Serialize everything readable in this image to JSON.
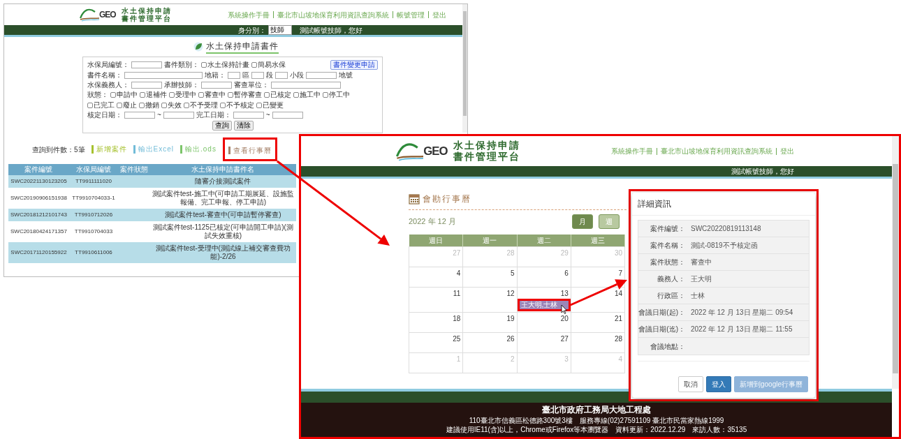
{
  "back_window": {
    "header": {
      "logo_text": "GEO",
      "title_lines": [
        "水土保持申請",
        "書件管理平台"
      ],
      "links": [
        "系統操作手冊",
        "臺北市山坡地保育利用資訊查詢系統",
        "帳號管理",
        "登出"
      ]
    },
    "user_bar": {
      "role_label": "身分別：",
      "role_value": "技師",
      "greeting": "測試帳號技師，您好"
    },
    "page_title": "水土保持申請書件",
    "search_form": [
      {
        "items": [
          {
            "kind": "label",
            "text": "水保局編號："
          },
          {
            "kind": "input",
            "wide": false
          },
          {
            "kind": "label",
            "text": "書件類別："
          },
          {
            "kind": "checkbox",
            "text": "水土保持計畫",
            "checked": false
          },
          {
            "kind": "checkbox",
            "text": "簡易水保",
            "checked": false
          },
          {
            "kind": "button",
            "text": "書件變更申請",
            "emphasis": true
          }
        ]
      },
      {
        "items": [
          {
            "kind": "label",
            "text": "書件名稱："
          },
          {
            "kind": "input",
            "wide": true
          },
          {
            "kind": "label",
            "text": "地籍："
          },
          {
            "kind": "select",
            "wide": false
          },
          {
            "kind": "label",
            "text": "區"
          },
          {
            "kind": "select",
            "wide": false
          },
          {
            "kind": "label",
            "text": "段"
          },
          {
            "kind": "select",
            "wide": false
          },
          {
            "kind": "label",
            "text": "小段"
          },
          {
            "kind": "input",
            "wide": false
          },
          {
            "kind": "label",
            "text": "地號"
          }
        ]
      },
      {
        "items": [
          {
            "kind": "label",
            "text": "水保義務人："
          },
          {
            "kind": "input",
            "wide": false
          },
          {
            "kind": "label",
            "text": "承辦技師："
          },
          {
            "kind": "input",
            "wide": false
          },
          {
            "kind": "label",
            "text": "審查單位："
          },
          {
            "kind": "select",
            "wide": true
          }
        ]
      },
      {
        "items": [
          {
            "kind": "label",
            "text": "狀態："
          },
          {
            "kind": "checkbox",
            "text": "申請中",
            "checked": false
          },
          {
            "kind": "checkbox",
            "text": "退補件",
            "checked": false
          },
          {
            "kind": "checkbox",
            "text": "受理中",
            "checked": false
          },
          {
            "kind": "checkbox",
            "text": "審查中",
            "checked": false
          },
          {
            "kind": "checkbox",
            "text": "暫停審查",
            "checked": false
          },
          {
            "kind": "checkbox",
            "text": "已核定",
            "checked": false
          },
          {
            "kind": "checkbox",
            "text": "施工中",
            "checked": false
          },
          {
            "kind": "checkbox",
            "text": "停工中",
            "checked": false
          },
          {
            "kind": "checkbox",
            "text": "已完工",
            "checked": false
          },
          {
            "kind": "checkbox",
            "text": "廢止",
            "checked": false
          },
          {
            "kind": "checkbox",
            "text": "撤銷",
            "checked": false
          },
          {
            "kind": "checkbox",
            "text": "失效",
            "checked": false
          },
          {
            "kind": "checkbox",
            "text": "不予受理",
            "checked": false
          },
          {
            "kind": "checkbox",
            "text": "不予核定",
            "checked": false
          },
          {
            "kind": "checkbox",
            "text": "已變更",
            "checked": false
          }
        ]
      },
      {
        "items": [
          {
            "kind": "label",
            "text": "核定日期："
          },
          {
            "kind": "input",
            "wide": false
          },
          {
            "kind": "label",
            "text": "~"
          },
          {
            "kind": "input",
            "wide": false
          },
          {
            "kind": "label",
            "text": "完工日期："
          },
          {
            "kind": "input",
            "wide": false
          },
          {
            "kind": "label",
            "text": "~"
          },
          {
            "kind": "input",
            "wide": false
          }
        ]
      },
      {
        "items": [
          {
            "kind": "button",
            "text": "查詢",
            "emphasis": false
          },
          {
            "kind": "button",
            "text": "清除",
            "emphasis": false
          }
        ]
      }
    ],
    "toolbar": {
      "count": "查詢到件數：5筆",
      "actions": [
        {
          "label": "新增案件",
          "color": "#a6c12e",
          "highlighted": false
        },
        {
          "label": "輸出Excel",
          "color": "#72bcd8",
          "highlighted": false
        },
        {
          "label": "輸出.ods",
          "color": "#7cc46a",
          "highlighted": false
        },
        {
          "label": "查看行事曆",
          "color": "#a5826a",
          "highlighted": true
        }
      ]
    },
    "table": {
      "columns": [
        "案件編號",
        "水保局編號",
        "案件狀態",
        "水土保持申請書件名"
      ],
      "rows": [
        [
          "SWC20221130123205",
          "TT9911111020",
          "",
          "隨審介接測試案件"
        ],
        [
          "SWC20190906151938",
          "TT9910704033-1",
          "",
          "測試案件test-施工中(可申請工期展延、設施監報備、完工申報、停工申請)"
        ],
        [
          "SWC20181212101743",
          "TT9910712026",
          "",
          "測試案件test-審查中(可申請暫停審查)"
        ],
        [
          "SWC20180424171357",
          "TT9910704033",
          "",
          "測試案件test-1125已核定(可申請開工申請)(測試失效重核)"
        ],
        [
          "SWC20171120155922",
          "TT9910611006",
          "",
          "測試案件test-受理中(測試線上補交審查費功能)-2/26"
        ]
      ]
    }
  },
  "front_window": {
    "highlighted": true,
    "header": {
      "logo_text": "GEO",
      "title_lines": [
        "水土保持申請",
        "書件管理平台"
      ],
      "links": [
        "系統操作手冊",
        "臺北市山坡地保育利用資訊查詢系統",
        "登出"
      ]
    },
    "user_bar": {
      "greeting": "測試帳號技師，您好"
    },
    "calendar": {
      "title": "會勘行事曆",
      "month_label": "2022 年 12 月",
      "views": [
        {
          "label": "月",
          "selected": true
        },
        {
          "label": "週",
          "selected": false
        }
      ],
      "weekdays": [
        "週日",
        "週一",
        "週二",
        "週三"
      ],
      "weeks": [
        [
          {
            "day": "27",
            "other_month": true
          },
          {
            "day": "28",
            "other_month": true
          },
          {
            "day": "29",
            "other_month": true
          },
          {
            "day": "30",
            "other_month": true
          }
        ],
        [
          {
            "day": "4",
            "other_month": false
          },
          {
            "day": "5",
            "other_month": false
          },
          {
            "day": "6",
            "other_month": false
          },
          {
            "day": "7",
            "other_month": false
          }
        ],
        [
          {
            "day": "11",
            "other_month": false
          },
          {
            "day": "12",
            "other_month": false
          },
          {
            "day": "13",
            "other_month": false,
            "events": [
              {
                "label": "王大明,士林",
                "highlighted": true
              }
            ]
          },
          {
            "day": "14",
            "other_month": false
          }
        ],
        [
          {
            "day": "18",
            "other_month": false
          },
          {
            "day": "19",
            "other_month": false
          },
          {
            "day": "20",
            "other_month": false
          },
          {
            "day": "21",
            "other_month": false
          }
        ],
        [
          {
            "day": "25",
            "other_month": false
          },
          {
            "day": "26",
            "other_month": false
          },
          {
            "day": "27",
            "other_month": false
          },
          {
            "day": "28",
            "other_month": false
          }
        ],
        [
          {
            "day": "1",
            "other_month": true
          },
          {
            "day": "2",
            "other_month": true
          },
          {
            "day": "3",
            "other_month": true
          },
          {
            "day": "4",
            "other_month": true
          }
        ]
      ]
    },
    "modal": {
      "highlighted": true,
      "title": "詳細資訊",
      "fields": [
        {
          "label": "案件編號：",
          "value": "SWC20220819113148"
        },
        {
          "label": "案件名稱：",
          "value": "測試-0819不予核定函"
        },
        {
          "label": "案件狀態：",
          "value": "審查中"
        },
        {
          "label": "義務人：",
          "value": "王大明"
        },
        {
          "label": "行政區：",
          "value": "士林"
        },
        {
          "label": "會議日期(起)：",
          "value": "2022 年 12 月 13日 星期二 09:54"
        },
        {
          "label": "會議日期(迄)：",
          "value": "2022 年 12 月 13日 星期二 11:55"
        },
        {
          "label": "會議地點："
        }
      ],
      "buttons": [
        {
          "label": "取消",
          "kind": "default",
          "disabled": false
        },
        {
          "label": "登入",
          "kind": "primary",
          "disabled": false
        },
        {
          "label": "新增到google行事曆",
          "kind": "primary",
          "disabled": true
        }
      ]
    },
    "footer": {
      "title": "臺北市政府工務局大地工程處",
      "lines": [
        "110臺北市信義區松德路300號3樓　服務專線(02)27591109 臺北市民當家熱線1999",
        "建議使用IE11(含)以上，Chrome或Firefox等本瀏覽器　資料更新：2022.12.29　來訪人數：35135"
      ]
    }
  }
}
